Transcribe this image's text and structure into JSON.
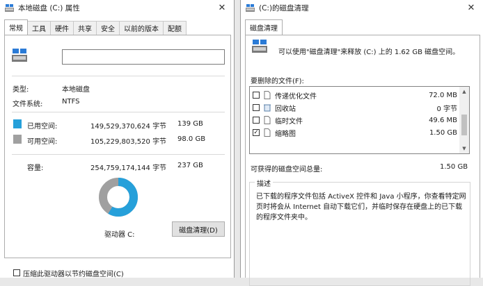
{
  "left_window": {
    "title": "本地磁盘 (C:) 属性",
    "tabs": [
      "常规",
      "工具",
      "硬件",
      "共享",
      "安全",
      "以前的版本",
      "配额"
    ],
    "active_tab": 0,
    "name_value": "",
    "type_label": "类型:",
    "type_value": "本地磁盘",
    "fs_label": "文件系统:",
    "fs_value": "NTFS",
    "used_label": "已用空间:",
    "used_bytes": "149,529,370,624 字节",
    "used_gb": "139 GB",
    "free_label": "可用空间:",
    "free_bytes": "105,229,803,520 字节",
    "free_gb": "98.0 GB",
    "capacity_label": "容量:",
    "capacity_bytes": "254,759,174,144 字节",
    "capacity_gb": "237 GB",
    "drive_label": "驱动器 C:",
    "cleanup_button": "磁盘清理(D)",
    "compress_label": "压缩此驱动器以节约磁盘空间(C)",
    "used_fraction": 0.587,
    "colors": {
      "used": "#26a0da",
      "free": "#a0a0a0"
    }
  },
  "right_window": {
    "title": "(C:)的磁盘清理",
    "tab": "磁盘清理",
    "summary": "可以使用\"磁盘清理\"来释放 (C:) 上的 1.62 GB 磁盘空间。",
    "files_label": "要删除的文件(F):",
    "files": [
      {
        "name": "传递优化文件",
        "size": "72.0 MB",
        "checked": false,
        "icon": "file-icon"
      },
      {
        "name": "回收站",
        "size": "0 字节",
        "checked": false,
        "icon": "recycle-bin-icon"
      },
      {
        "name": "临时文件",
        "size": "49.6 MB",
        "checked": false,
        "icon": "file-icon"
      },
      {
        "name": "缩略图",
        "size": "1.50 GB",
        "checked": true,
        "icon": "file-icon"
      }
    ],
    "total_label": "可获得的磁盘空间总量:",
    "total_value": "1.50 GB",
    "description_legend": "描述",
    "description": "已下载的程序文件包括 ActiveX 控件和 Java 小程序，你查看特定网页时将会从 Internet 自动下载它们，并临时保存在硬盘上的已下载的程序文件夹中。"
  }
}
